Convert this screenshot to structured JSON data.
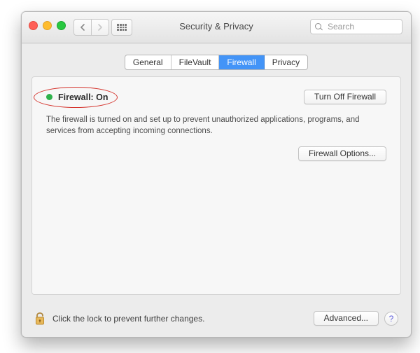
{
  "window": {
    "title": "Security & Privacy",
    "search_placeholder": "Search"
  },
  "tabs": {
    "general": "General",
    "filevault": "FileVault",
    "firewall": "Firewall",
    "privacy": "Privacy"
  },
  "status": {
    "label": "Firewall: On",
    "description": "The firewall is turned on and set up to prevent unauthorized applications, programs, and services from accepting incoming connections."
  },
  "buttons": {
    "turn_off": "Turn Off Firewall",
    "options": "Firewall Options...",
    "advanced": "Advanced...",
    "help": "?"
  },
  "footer": {
    "lock_text": "Click the lock to prevent further changes."
  }
}
